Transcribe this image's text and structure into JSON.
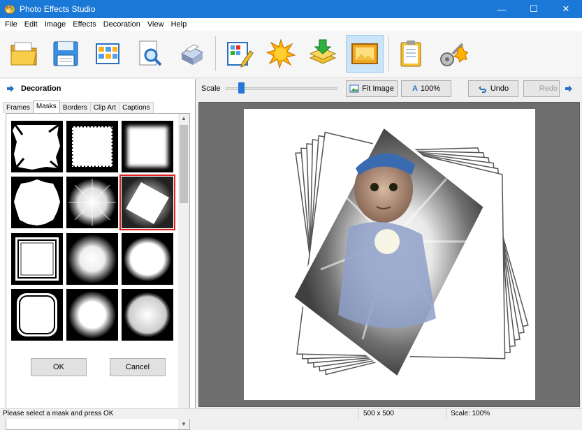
{
  "window": {
    "title": "Photo Effects Studio",
    "minimize": "—",
    "maximize": "☐",
    "close": "✕"
  },
  "menu": [
    "File",
    "Edit",
    "Image",
    "Effects",
    "Decoration",
    "View",
    "Help"
  ],
  "toolbar": {
    "icons": [
      "open-folder-icon",
      "save-disk-icon",
      "gallery-icon",
      "preview-magnifier-icon",
      "printer-icon",
      "edit-grid-pencil-icon",
      "sun-effects-icon",
      "layers-download-icon",
      "image-frame-icon",
      "clipboard-icon",
      "settings-gear-icon"
    ],
    "active": "image-frame-icon"
  },
  "panel": {
    "title": "Decoration",
    "tabs": [
      "Frames",
      "Masks",
      "Borders",
      "Clip Art",
      "Captions"
    ],
    "active_tab": "Masks",
    "masks": [
      "mask-1",
      "mask-2",
      "mask-3",
      "mask-4",
      "mask-5",
      "mask-6",
      "mask-7",
      "mask-8",
      "mask-9",
      "mask-10",
      "mask-11",
      "mask-12"
    ],
    "selected_mask": 6,
    "ok": "OK",
    "cancel": "Cancel"
  },
  "view": {
    "scale_label": "Scale",
    "scale_level": 0.14,
    "fit_image": "Fit Image",
    "zoom": "100%",
    "undo": "Undo",
    "redo": "Redo"
  },
  "status": {
    "hint": "Please select a mask and press OK",
    "size": "500 x 500",
    "scale": "Scale: 100%"
  },
  "colors": {
    "titlebar": "#1a78d6",
    "selection": "#e02020",
    "accent": "#2477d8"
  }
}
